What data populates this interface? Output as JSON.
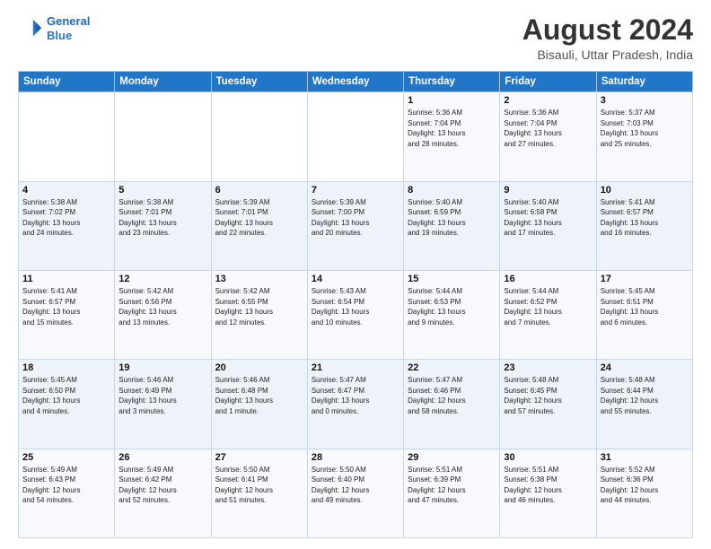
{
  "logo": {
    "line1": "General",
    "line2": "Blue"
  },
  "title": "August 2024",
  "subtitle": "Bisauli, Uttar Pradesh, India",
  "days_of_week": [
    "Sunday",
    "Monday",
    "Tuesday",
    "Wednesday",
    "Thursday",
    "Friday",
    "Saturday"
  ],
  "weeks": [
    [
      {
        "day": "",
        "info": ""
      },
      {
        "day": "",
        "info": ""
      },
      {
        "day": "",
        "info": ""
      },
      {
        "day": "",
        "info": ""
      },
      {
        "day": "1",
        "info": "Sunrise: 5:36 AM\nSunset: 7:04 PM\nDaylight: 13 hours\nand 28 minutes."
      },
      {
        "day": "2",
        "info": "Sunrise: 5:36 AM\nSunset: 7:04 PM\nDaylight: 13 hours\nand 27 minutes."
      },
      {
        "day": "3",
        "info": "Sunrise: 5:37 AM\nSunset: 7:03 PM\nDaylight: 13 hours\nand 25 minutes."
      }
    ],
    [
      {
        "day": "4",
        "info": "Sunrise: 5:38 AM\nSunset: 7:02 PM\nDaylight: 13 hours\nand 24 minutes."
      },
      {
        "day": "5",
        "info": "Sunrise: 5:38 AM\nSunset: 7:01 PM\nDaylight: 13 hours\nand 23 minutes."
      },
      {
        "day": "6",
        "info": "Sunrise: 5:39 AM\nSunset: 7:01 PM\nDaylight: 13 hours\nand 22 minutes."
      },
      {
        "day": "7",
        "info": "Sunrise: 5:39 AM\nSunset: 7:00 PM\nDaylight: 13 hours\nand 20 minutes."
      },
      {
        "day": "8",
        "info": "Sunrise: 5:40 AM\nSunset: 6:59 PM\nDaylight: 13 hours\nand 19 minutes."
      },
      {
        "day": "9",
        "info": "Sunrise: 5:40 AM\nSunset: 6:58 PM\nDaylight: 13 hours\nand 17 minutes."
      },
      {
        "day": "10",
        "info": "Sunrise: 5:41 AM\nSunset: 6:57 PM\nDaylight: 13 hours\nand 16 minutes."
      }
    ],
    [
      {
        "day": "11",
        "info": "Sunrise: 5:41 AM\nSunset: 6:57 PM\nDaylight: 13 hours\nand 15 minutes."
      },
      {
        "day": "12",
        "info": "Sunrise: 5:42 AM\nSunset: 6:56 PM\nDaylight: 13 hours\nand 13 minutes."
      },
      {
        "day": "13",
        "info": "Sunrise: 5:42 AM\nSunset: 6:55 PM\nDaylight: 13 hours\nand 12 minutes."
      },
      {
        "day": "14",
        "info": "Sunrise: 5:43 AM\nSunset: 6:54 PM\nDaylight: 13 hours\nand 10 minutes."
      },
      {
        "day": "15",
        "info": "Sunrise: 5:44 AM\nSunset: 6:53 PM\nDaylight: 13 hours\nand 9 minutes."
      },
      {
        "day": "16",
        "info": "Sunrise: 5:44 AM\nSunset: 6:52 PM\nDaylight: 13 hours\nand 7 minutes."
      },
      {
        "day": "17",
        "info": "Sunrise: 5:45 AM\nSunset: 6:51 PM\nDaylight: 13 hours\nand 6 minutes."
      }
    ],
    [
      {
        "day": "18",
        "info": "Sunrise: 5:45 AM\nSunset: 6:50 PM\nDaylight: 13 hours\nand 4 minutes."
      },
      {
        "day": "19",
        "info": "Sunrise: 5:46 AM\nSunset: 6:49 PM\nDaylight: 13 hours\nand 3 minutes."
      },
      {
        "day": "20",
        "info": "Sunrise: 5:46 AM\nSunset: 6:48 PM\nDaylight: 13 hours\nand 1 minute."
      },
      {
        "day": "21",
        "info": "Sunrise: 5:47 AM\nSunset: 6:47 PM\nDaylight: 13 hours\nand 0 minutes."
      },
      {
        "day": "22",
        "info": "Sunrise: 5:47 AM\nSunset: 6:46 PM\nDaylight: 12 hours\nand 58 minutes."
      },
      {
        "day": "23",
        "info": "Sunrise: 5:48 AM\nSunset: 6:45 PM\nDaylight: 12 hours\nand 57 minutes."
      },
      {
        "day": "24",
        "info": "Sunrise: 5:48 AM\nSunset: 6:44 PM\nDaylight: 12 hours\nand 55 minutes."
      }
    ],
    [
      {
        "day": "25",
        "info": "Sunrise: 5:49 AM\nSunset: 6:43 PM\nDaylight: 12 hours\nand 54 minutes."
      },
      {
        "day": "26",
        "info": "Sunrise: 5:49 AM\nSunset: 6:42 PM\nDaylight: 12 hours\nand 52 minutes."
      },
      {
        "day": "27",
        "info": "Sunrise: 5:50 AM\nSunset: 6:41 PM\nDaylight: 12 hours\nand 51 minutes."
      },
      {
        "day": "28",
        "info": "Sunrise: 5:50 AM\nSunset: 6:40 PM\nDaylight: 12 hours\nand 49 minutes."
      },
      {
        "day": "29",
        "info": "Sunrise: 5:51 AM\nSunset: 6:39 PM\nDaylight: 12 hours\nand 47 minutes."
      },
      {
        "day": "30",
        "info": "Sunrise: 5:51 AM\nSunset: 6:38 PM\nDaylight: 12 hours\nand 46 minutes."
      },
      {
        "day": "31",
        "info": "Sunrise: 5:52 AM\nSunset: 6:36 PM\nDaylight: 12 hours\nand 44 minutes."
      }
    ]
  ]
}
